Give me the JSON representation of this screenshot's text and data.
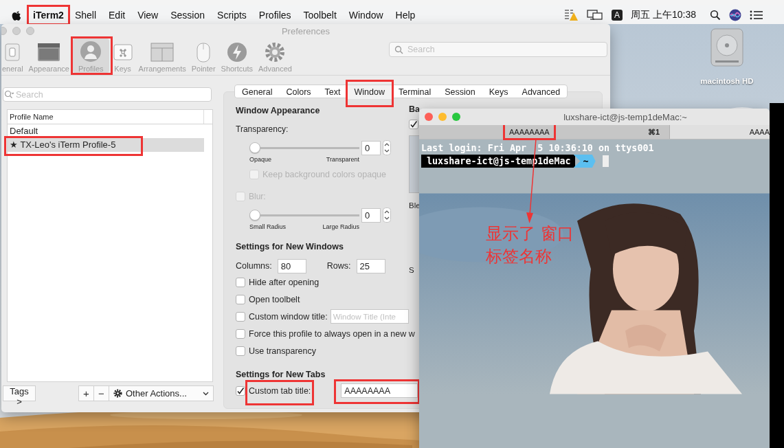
{
  "menu_bar": {
    "app_name": {
      "label": "iTerm2",
      "highlighted": true
    },
    "menus": [
      "Shell",
      "Edit",
      "View",
      "Session",
      "Scripts",
      "Profiles",
      "Toolbelt",
      "Window",
      "Help"
    ],
    "input_source": "A",
    "clock": "周五 上午10:38"
  },
  "desktop_icons": [
    {
      "label": "macintosh HD"
    }
  ],
  "preferences": {
    "title": "Preferences",
    "toolbar": [
      {
        "kind": "general",
        "label": "eneral",
        "selected": false,
        "highlighted": false
      },
      {
        "kind": "appearance",
        "label": "Appearance",
        "selected": false,
        "highlighted": false
      },
      {
        "kind": "profiles",
        "label": "Profiles",
        "selected": true,
        "highlighted": true
      },
      {
        "kind": "keys",
        "label": "Keys",
        "selected": false,
        "highlighted": false
      },
      {
        "kind": "arrangements",
        "label": "Arrangements",
        "selected": false,
        "highlighted": false
      },
      {
        "kind": "pointer",
        "label": "Pointer",
        "selected": false,
        "highlighted": false
      },
      {
        "kind": "shortcuts",
        "label": "Shortcuts",
        "selected": false,
        "highlighted": false
      },
      {
        "kind": "advanced",
        "label": "Advanced",
        "selected": false,
        "highlighted": false
      }
    ],
    "search": {
      "placeholder": "Search"
    },
    "profile_search": {
      "placeholder": "Search"
    },
    "profiles": {
      "column": "Profile Name",
      "rows": [
        {
          "name": "Default",
          "selected": false,
          "highlighted": false
        },
        {
          "name": "★ TX-Leo's iTerm Profile-5",
          "selected": true,
          "highlighted": true
        }
      ]
    },
    "profile_actions": {
      "tags": "Tags >",
      "add": "+",
      "remove": "−",
      "other_actions": "Other Actions..."
    },
    "tabs": [
      {
        "label": "General",
        "selected": false,
        "highlighted": false
      },
      {
        "label": "Colors",
        "selected": false,
        "highlighted": false
      },
      {
        "label": "Text",
        "selected": false,
        "highlighted": false
      },
      {
        "label": "Window",
        "selected": true,
        "highlighted": true
      },
      {
        "label": "Terminal",
        "selected": false,
        "highlighted": false
      },
      {
        "label": "Session",
        "selected": false,
        "highlighted": false
      },
      {
        "label": "Keys",
        "selected": false,
        "highlighted": false
      },
      {
        "label": "Advanced",
        "selected": false,
        "highlighted": false
      }
    ],
    "window_appearance": {
      "heading": "Window Appearance",
      "transparency": {
        "label": "Transparency:",
        "level": 0,
        "value": "0",
        "min_label": "Opaque",
        "max_label": "Transparent"
      },
      "keep_opaque": {
        "label": "Keep background colors opaque",
        "checked": false,
        "disabled": true
      },
      "blur": {
        "label": "Blur:",
        "checked": false,
        "disabled": true,
        "level": 0,
        "value": "0",
        "min_label": "Small Radius",
        "max_label": "Large Radius"
      }
    },
    "new_windows": {
      "heading": "Settings for New Windows",
      "columns": {
        "label": "Columns:",
        "value": "80"
      },
      "rows": {
        "label": "Rows:",
        "value": "25"
      },
      "options": [
        {
          "label": "Hide after opening",
          "checked": false
        },
        {
          "label": "Open toolbelt",
          "checked": false
        },
        {
          "label": "Custom window title:",
          "checked": false,
          "placeholder": "Window Title (Inte"
        },
        {
          "label": "Force this profile to always open in a new w",
          "checked": false
        },
        {
          "label": "Use transparency",
          "checked": false
        }
      ]
    },
    "new_tabs": {
      "heading": "Settings for New Tabs",
      "custom_tab_title": {
        "label": "Custom tab title:",
        "checked": true,
        "highlighted": true,
        "value": "AAAAAAAA",
        "value_highlighted": true
      }
    },
    "column_2": {
      "heading": "Ba",
      "checkbox": {
        "checked": true
      },
      "text_1": "Ble",
      "text_2": "S"
    }
  },
  "terminal": {
    "title": "luxshare-ict@js-temp1deMac:~",
    "tabs": [
      {
        "title": "AAAAAAAA",
        "shortcut": "⌘1",
        "selected": false,
        "highlighted": true
      },
      {
        "title": "AAAA",
        "selected": true,
        "highlighted": false
      }
    ],
    "lines": [
      {
        "kind": "text",
        "text": "Last login: Fri Apr  5 10:36:10 on ttys001"
      },
      {
        "kind": "prompt",
        "host": "luxshare-ict@js-temp1deMac",
        "dir": "~"
      }
    ],
    "annotation": {
      "lines": [
        "显示了 窗口",
        "标签名称"
      ]
    }
  }
}
